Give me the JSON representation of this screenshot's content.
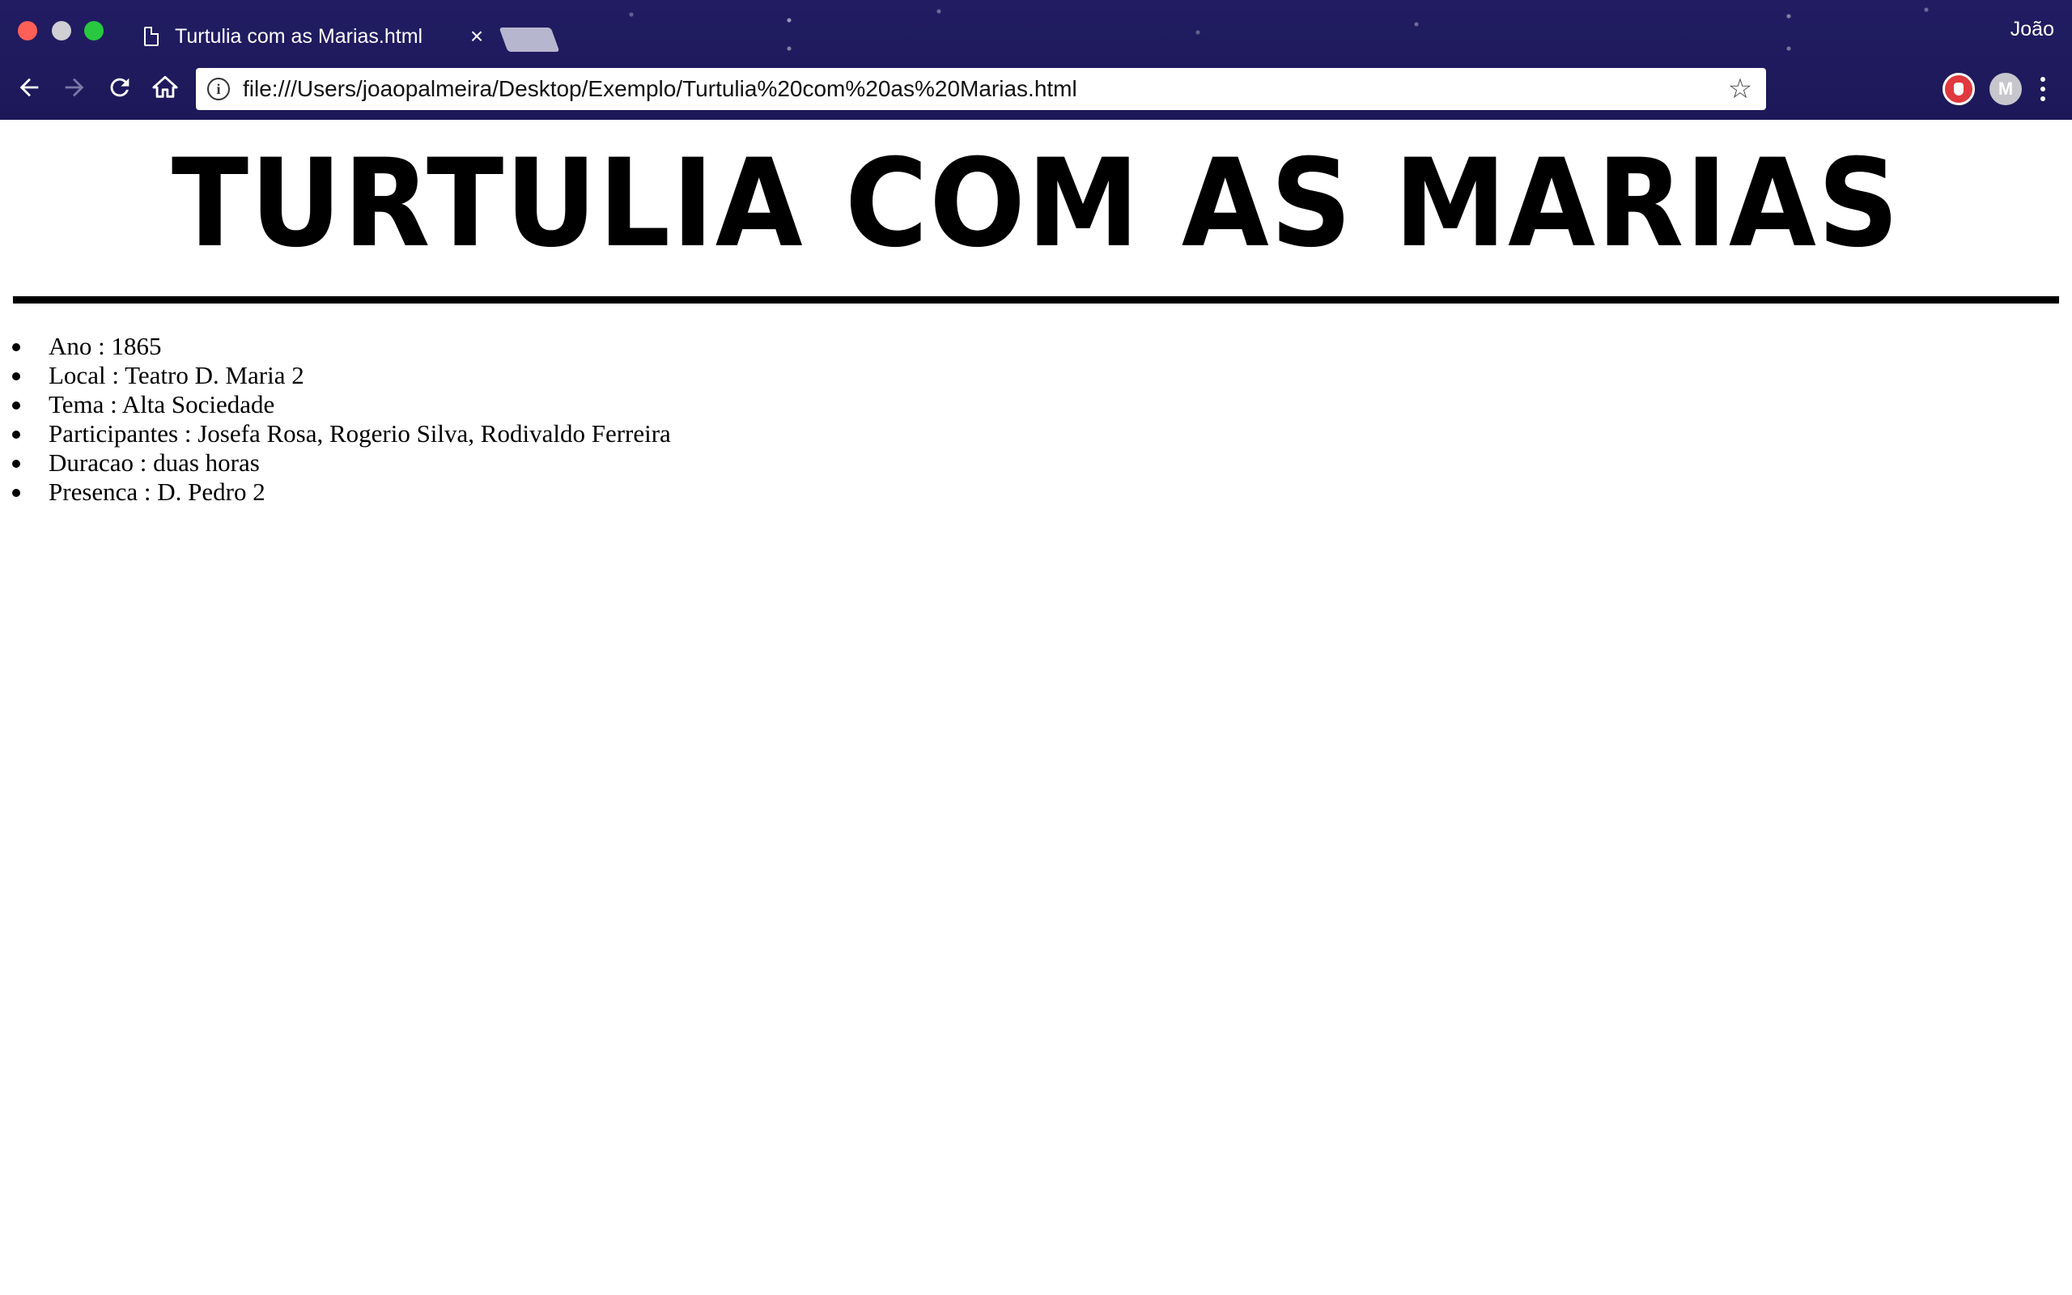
{
  "browser": {
    "tab_title": "Turtulia com as Marias.html",
    "tab_close_glyph": "×",
    "profile_name": "João",
    "address_bar_url": "file:///Users/joaopalmeira/Desktop/Exemplo/Turtulia%20com%20as%20Marias.html",
    "info_glyph": "i",
    "star_glyph": "☆",
    "extension_m_label": "M",
    "icons": [
      "document-icon",
      "back-arrow-icon",
      "forward-arrow-icon",
      "reload-icon",
      "home-icon",
      "info-icon",
      "star-icon",
      "adblock-icon",
      "menu-icon"
    ]
  },
  "page": {
    "heading": "TURTULIA COM AS MARIAS",
    "details": [
      {
        "label": "Ano",
        "value": "1865",
        "text": "Ano : 1865"
      },
      {
        "label": "Local",
        "value": "Teatro D. Maria 2",
        "text": "Local : Teatro D. Maria 2"
      },
      {
        "label": "Tema",
        "value": "Alta Sociedade",
        "text": "Tema : Alta Sociedade"
      },
      {
        "label": "Participantes",
        "value": "Josefa Rosa, Rogerio Silva, Rodivaldo Ferreira",
        "text": "Participantes : Josefa Rosa, Rogerio Silva, Rodivaldo Ferreira"
      },
      {
        "label": "Duracao",
        "value": "duas horas",
        "text": "Duracao : duas horas"
      },
      {
        "label": "Presenca",
        "value": "D. Pedro 2",
        "text": "Presenca : D. Pedro 2"
      }
    ]
  },
  "colors": {
    "chrome_background": "#1f1b5c",
    "close_button": "#fe5f57",
    "minimize_button_inactive": "#cfcfd4",
    "zoom_button": "#28c840",
    "adblock_red": "#e0393e",
    "page_background": "#ffffff",
    "text": "#000000"
  }
}
